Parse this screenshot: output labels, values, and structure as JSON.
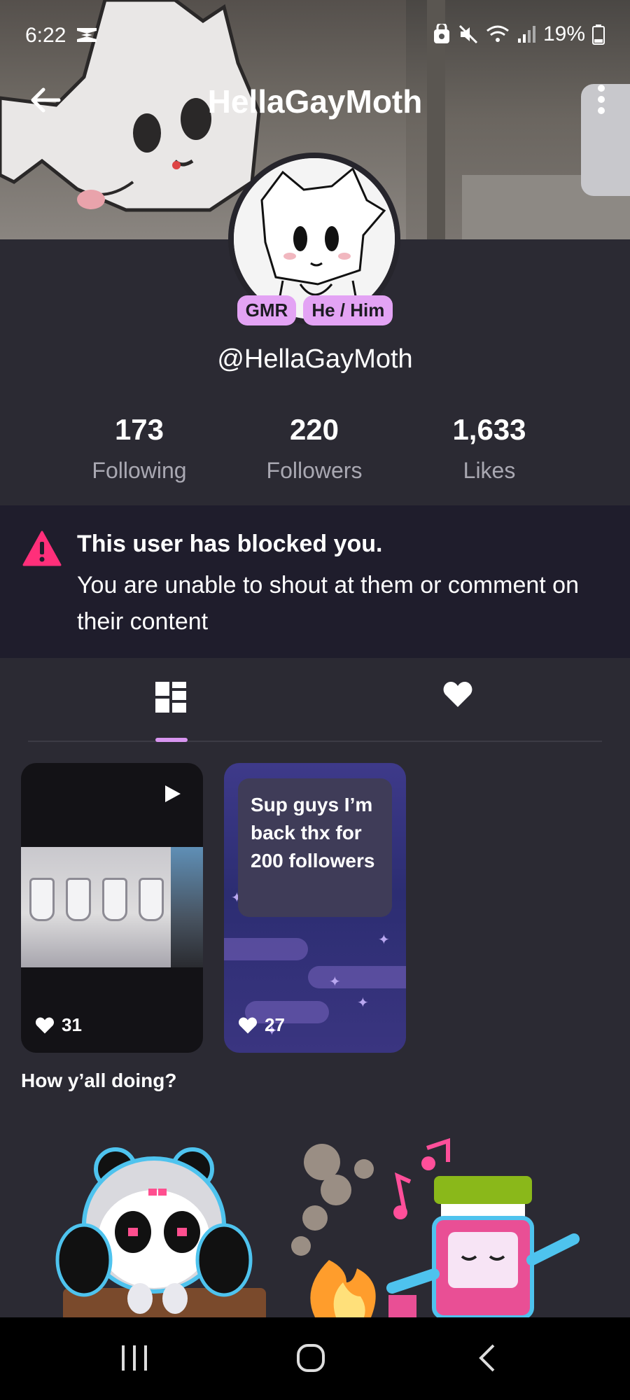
{
  "status_bar": {
    "time": "6:22",
    "battery": "19%"
  },
  "header": {
    "title": "HellaGayMoth"
  },
  "profile": {
    "badges": [
      "GMR",
      "He / Him"
    ],
    "handle": "@HellaGayMoth",
    "stats": [
      {
        "value": "173",
        "label": "Following"
      },
      {
        "value": "220",
        "label": "Followers"
      },
      {
        "value": "1,633",
        "label": "Likes"
      }
    ]
  },
  "notice": {
    "heading": "This user has blocked you.",
    "body": "You are unable to shout at them or comment on their content"
  },
  "tabs": [
    {
      "icon": "grid-icon",
      "active": true
    },
    {
      "icon": "heart-icon",
      "active": false
    }
  ],
  "posts": [
    {
      "likes": "31",
      "caption": "How y’all doing?"
    },
    {
      "likes": "27",
      "text": "Sup guys I’m back thx for 200 followers"
    }
  ],
  "colors": {
    "background": "#2b2a33",
    "accent": "#d895f0",
    "badge": "#e3a3f4",
    "warning": "#ff2f7a",
    "notice_bg": "#1f1d2c"
  }
}
